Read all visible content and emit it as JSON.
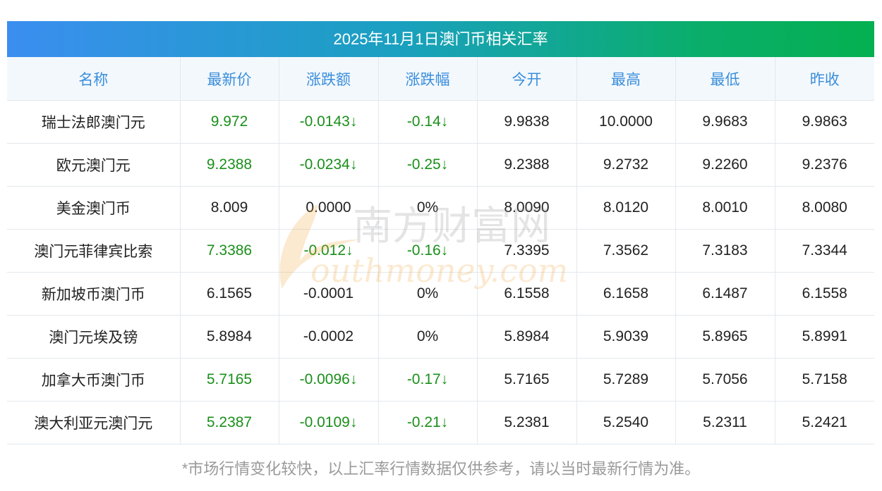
{
  "title": "2025年11月1日澳门币相关汇率",
  "headers": [
    "名称",
    "最新价",
    "涨跌额",
    "涨跌幅",
    "今开",
    "最高",
    "最低",
    "昨收"
  ],
  "rows": [
    [
      "瑞士法郎澳门元",
      "9.972",
      "-0.0143↓",
      "-0.14↓",
      "9.9838",
      "10.0000",
      "9.9683",
      "9.9863"
    ],
    [
      "欧元澳门元",
      "9.2388",
      "-0.0234↓",
      "-0.25↓",
      "9.2388",
      "9.2732",
      "9.2260",
      "9.2376"
    ],
    [
      "美金澳门币",
      "8.009",
      "0.0000",
      "0%",
      "8.0090",
      "8.0120",
      "8.0010",
      "8.0080"
    ],
    [
      "澳门元菲律宾比索",
      "7.3386",
      "-0.012↓",
      "-0.16↓",
      "7.3395",
      "7.3562",
      "7.3183",
      "7.3344"
    ],
    [
      "新加坡币澳门币",
      "6.1565",
      "-0.0001",
      "0%",
      "6.1558",
      "6.1658",
      "6.1487",
      "6.1558"
    ],
    [
      "澳门元埃及镑",
      "5.8984",
      "-0.0002",
      "0%",
      "5.8984",
      "5.9039",
      "5.8965",
      "5.8991"
    ],
    [
      "加拿大币澳门币",
      "5.7165",
      "-0.0096↓",
      "-0.17↓",
      "5.7165",
      "5.7289",
      "5.7056",
      "5.7158"
    ],
    [
      "澳大利亚元澳门元",
      "5.2387",
      "-0.0109↓",
      "-0.21↓",
      "5.2381",
      "5.2540",
      "5.2311",
      "5.2421"
    ]
  ],
  "row_down": [
    true,
    true,
    false,
    true,
    false,
    false,
    true,
    true
  ],
  "watermark": {
    "cn": "南方财富网",
    "en": "outhmoney.com"
  },
  "footnote": "*市场行情变化较快，以上汇率行情数据仅供参考，请以当时最新行情为准。",
  "colors": {
    "header_text": "#3a8edb",
    "header_bg": "#f3f8fd",
    "down": "#1a8f1a",
    "gradient_start": "#3b8ef0",
    "gradient_end": "#04b050"
  }
}
